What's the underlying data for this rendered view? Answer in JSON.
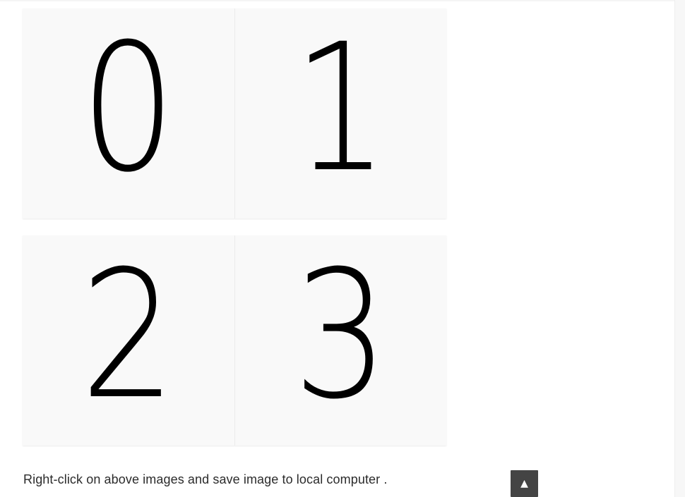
{
  "tiles": [
    {
      "label": "0"
    },
    {
      "label": "1"
    },
    {
      "label": "2"
    },
    {
      "label": "3"
    }
  ],
  "instructions": "Right-click on above images and save image to local computer .",
  "scroll_top_button": {
    "icon": "arrow-up-icon",
    "glyph": "▲"
  },
  "colors": {
    "tile_background": "#f9f9f9",
    "digit": "#000000",
    "button_background": "#444444"
  }
}
